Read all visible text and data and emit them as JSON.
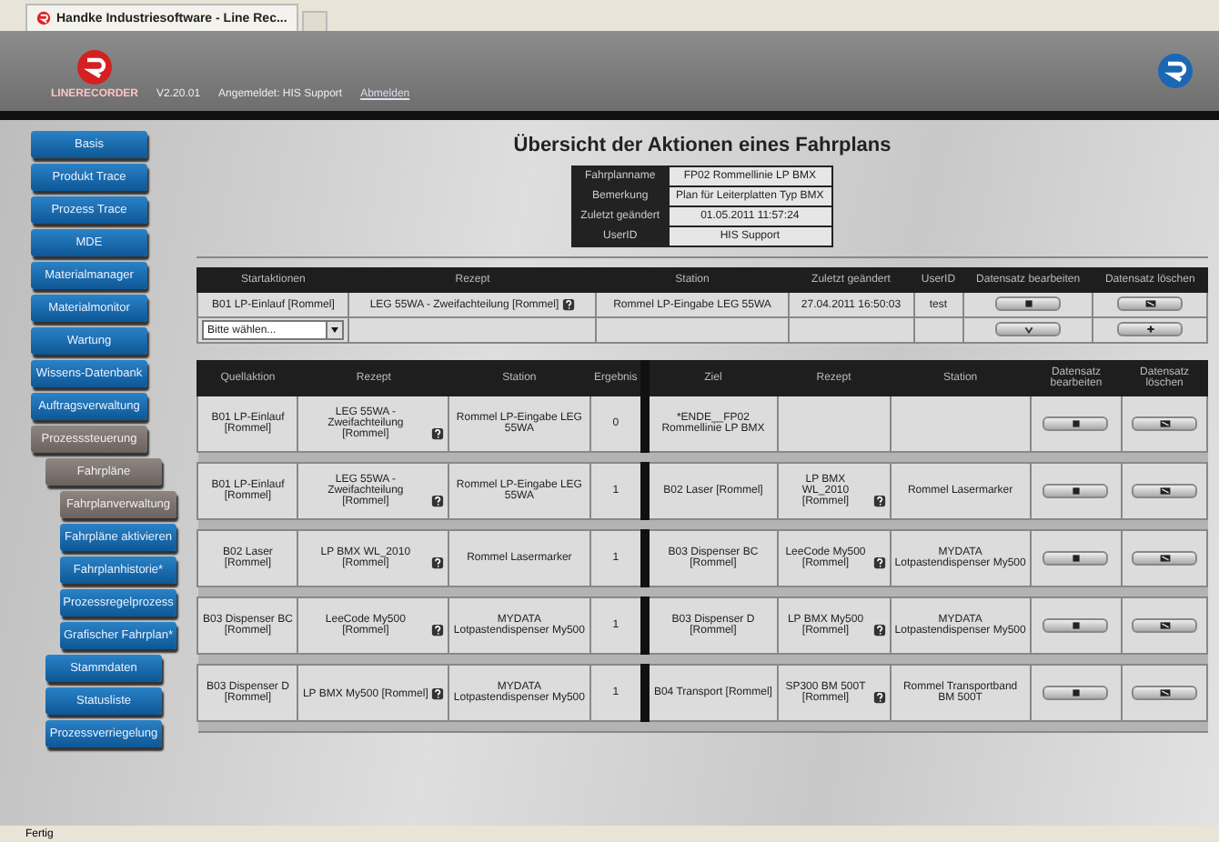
{
  "browser_tab": {
    "title": "Handke Industriesoftware - Line Rec..."
  },
  "header": {
    "logo_text": "LINERECORDER",
    "version": "V2.20.01",
    "user": "Angemeldet: HIS Support",
    "logout": "Abmelden"
  },
  "sidebar": {
    "items": [
      {
        "label": "Basis",
        "selected": false
      },
      {
        "label": "Produkt Trace",
        "selected": false
      },
      {
        "label": "Prozess Trace",
        "selected": false
      },
      {
        "label": "MDE",
        "selected": false
      },
      {
        "label": "Materialmanager",
        "selected": false
      },
      {
        "label": "Materialmonitor",
        "selected": false
      },
      {
        "label": "Wartung",
        "selected": false
      },
      {
        "label": "Wissens-Datenbank",
        "selected": false
      },
      {
        "label": "Auftragsverwaltung",
        "selected": false
      },
      {
        "label": "Prozesssteuerung",
        "selected": true,
        "children": [
          {
            "label": "Fahrpläne",
            "selected": true,
            "children": [
              {
                "label": "Fahrplanverwaltung",
                "selected": true
              },
              {
                "label": "Fahrpläne aktivieren",
                "selected": false
              },
              {
                "label": "Fahrplanhistorie*",
                "selected": false
              },
              {
                "label": "Prozessregelprozess",
                "selected": false
              },
              {
                "label": "Grafischer Fahrplan*",
                "selected": false
              }
            ]
          },
          {
            "label": "Stammdaten",
            "selected": false
          },
          {
            "label": "Statusliste",
            "selected": false
          },
          {
            "label": "Prozessverriegelung",
            "selected": false
          }
        ]
      }
    ]
  },
  "page_title": "Übersicht der Aktionen eines Fahrplans",
  "summary": [
    {
      "label": "Fahrplanname",
      "value": "FP02 Rommellinie LP BMX"
    },
    {
      "label": "Bemerkung",
      "value": "Plan für Leiterplatten Typ BMX"
    },
    {
      "label": "Zuletzt geändert",
      "value": "01.05.2011 11:57:24"
    },
    {
      "label": "UserID",
      "value": "HIS Support"
    }
  ],
  "start_table": {
    "columns": [
      "Startaktionen",
      "Rezept",
      "Station",
      "Zuletzt geändert",
      "UserID",
      "Datensatz bearbeiten",
      "Datensatz löschen"
    ],
    "rows": [
      {
        "action": "B01 LP-Einlauf [Rommel]",
        "recipe": "LEG 55WA - Zweifachteilung [Rommel]",
        "recipe_help": true,
        "station": "Rommel LP-Eingabe LEG 55WA",
        "changed": "27.04.2011 16:50:03",
        "user": "test"
      }
    ],
    "new_row": {
      "select_value": "Bitte wählen..."
    }
  },
  "transitions": {
    "columns": [
      "Quellaktion",
      "Rezept",
      "Station",
      "Ergebnis",
      "Ziel",
      "Rezept",
      "Station",
      "Datensatz bearbeiten",
      "Datensatz löschen"
    ],
    "rows": [
      {
        "source": {
          "action": "B01 LP-Einlauf [Rommel]",
          "recipe": "LEG 55WA - Zweifachteilung [Rommel]",
          "recipe_help": true,
          "station": "Rommel LP-Eingabe LEG 55WA"
        },
        "result": "0",
        "target": {
          "action": "*ENDE__FP02 Rommellinie LP BMX",
          "recipe_help": false
        }
      },
      {
        "source": {
          "action": "B01 LP-Einlauf [Rommel]",
          "recipe": "LEG 55WA - Zweifachteilung [Rommel]",
          "recipe_help": true,
          "station": "Rommel LP-Eingabe LEG 55WA"
        },
        "result": "1",
        "target": {
          "action": "B02 Laser [Rommel]",
          "recipe": "LP BMX WL_2010 [Rommel]",
          "recipe_help": true,
          "station": "Rommel Lasermarker"
        }
      },
      {
        "source": {
          "action": "B02 Laser [Rommel]",
          "recipe": "LP BMX WL_2010 [Rommel]",
          "recipe_help": true,
          "station": "Rommel Lasermarker"
        },
        "result": "1",
        "target": {
          "action": "B03 Dispenser BC [Rommel]",
          "recipe": "LeeCode My500 [Rommel]",
          "recipe_help": true,
          "station": "MYDATA Lotpastendispenser My500"
        }
      },
      {
        "source": {
          "action": "B03 Dispenser BC [Rommel]",
          "recipe": "LeeCode My500 [Rommel]",
          "recipe_help": true,
          "station": "MYDATA Lotpastendispenser My500"
        },
        "result": "1",
        "target": {
          "action": "B03 Dispenser D [Rommel]",
          "recipe": "LP BMX My500 [Rommel]",
          "recipe_help": true,
          "station": "MYDATA Lotpastendispenser My500"
        }
      },
      {
        "source": {
          "action": "B03 Dispenser D [Rommel]",
          "recipe": "LP BMX My500 [Rommel]",
          "recipe_help": true,
          "station": "MYDATA Lotpastendispenser My500"
        },
        "result": "1",
        "target": {
          "action": "B04 Transport [Rommel]",
          "recipe": "SP300 BM 500T [Rommel]",
          "recipe_help": true,
          "station": "Rommel Transportband BM 500T"
        }
      }
    ]
  },
  "status_bar": {
    "text": "Fertig"
  }
}
